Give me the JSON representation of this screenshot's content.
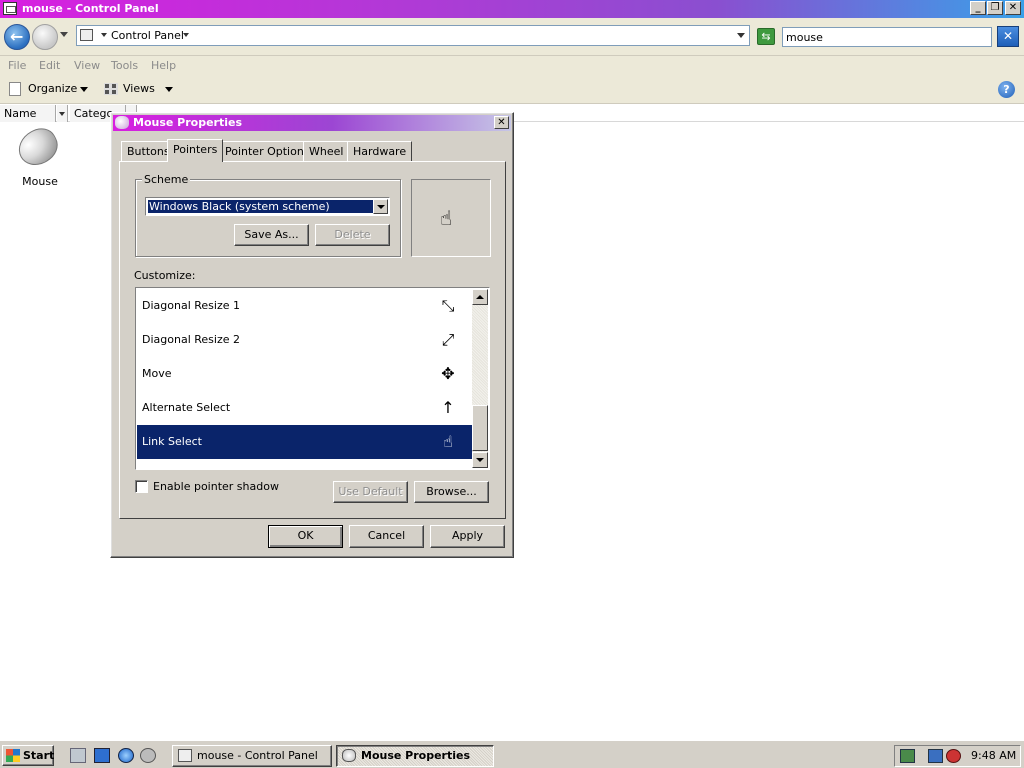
{
  "window": {
    "title": "mouse  - Control Panel",
    "min": "_",
    "restore": "❐",
    "close": "✕"
  },
  "address": {
    "crumb": "Control Panel",
    "search_value": "mouse",
    "refresh_glyph": "⇆",
    "clear_glyph": "✕"
  },
  "menu": {
    "file": "File",
    "edit": "Edit",
    "view": "View",
    "tools": "Tools",
    "help": "Help"
  },
  "toolbar": {
    "organize": "Organize",
    "views": "Views",
    "help_glyph": "?"
  },
  "columns": {
    "name": "Name",
    "category": "Catego"
  },
  "items": [
    {
      "label": "Mouse",
      "icon": "mouse-icon"
    }
  ],
  "dialog": {
    "title": "Mouse Properties",
    "close": "✕",
    "tabs": [
      "Buttons",
      "Pointers",
      "Pointer Options",
      "Wheel",
      "Hardware"
    ],
    "active_tab": "Pointers",
    "scheme_label": "Scheme",
    "scheme_value": "Windows Black (system scheme)",
    "save_as": "Save As...",
    "delete": "Delete",
    "preview_glyph": "☝",
    "customize_label": "Customize:",
    "cursors": [
      {
        "name": "Diagonal Resize 1",
        "glyph": "⤡"
      },
      {
        "name": "Diagonal Resize 2",
        "glyph": "⤢"
      },
      {
        "name": "Move",
        "glyph": "✥"
      },
      {
        "name": "Alternate Select",
        "glyph": "↑"
      },
      {
        "name": "Link Select",
        "glyph": "☝"
      }
    ],
    "selected_cursor": "Link Select",
    "shadow_label": "Enable pointer shadow",
    "shadow_checked": false,
    "use_default": "Use Default",
    "browse": "Browse...",
    "ok": "OK",
    "cancel": "Cancel",
    "apply": "Apply"
  },
  "taskbar": {
    "start": "Start",
    "tasks": [
      {
        "label": "mouse  - Control Panel",
        "active": false
      },
      {
        "label": "Mouse Properties",
        "active": true
      }
    ],
    "clock": "9:48 AM"
  },
  "colors": {
    "title_gradient_start": "#d81fe0",
    "title_gradient_end": "#3aa0e8",
    "selection": "#0a246a",
    "face": "#d4d0c8"
  }
}
